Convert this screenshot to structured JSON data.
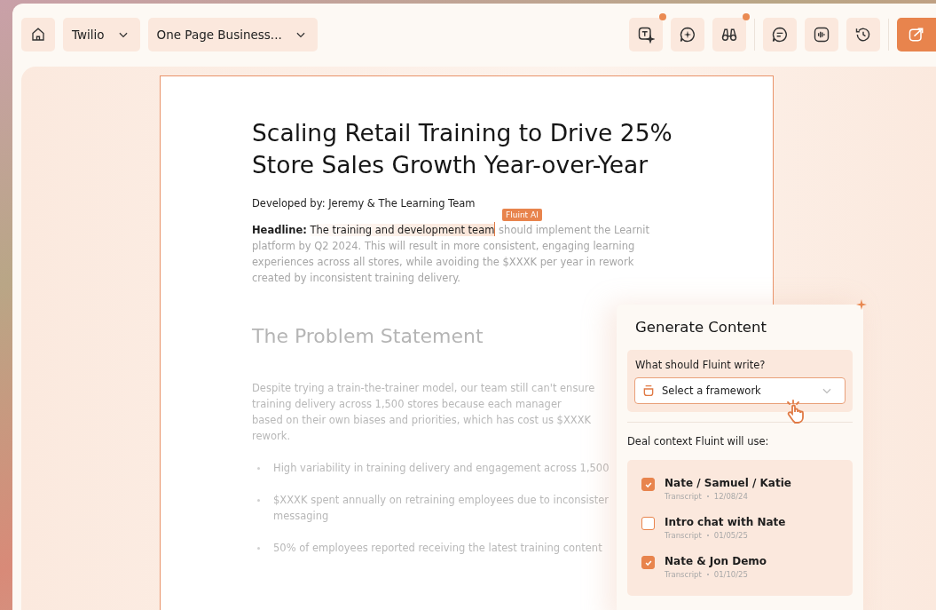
{
  "toolbar": {
    "account": {
      "label": "Twilio"
    },
    "document": {
      "label": "One Page Business..."
    },
    "tool_groups": [
      [
        {
          "badge": true
        },
        {
          "badge": false
        },
        {
          "badge": true
        }
      ],
      [
        {
          "badge": false
        },
        {
          "badge": false
        },
        {
          "badge": false
        }
      ]
    ]
  },
  "document": {
    "title": "Scaling Retail Training to Drive 25% Store Sales Growth Year-over-Year",
    "byline": "Developed by: Jeremy & The Learning Team",
    "headline": {
      "label": "Headline:",
      "highlighted": "The training and development team",
      "rest": "should implement the Learnit platform by Q2 2024. This will result in more consistent, engaging learning experiences across all stores, while avoiding the $XXXK per year in rework created by inconsistent training delivery.",
      "tag": "Fluint AI"
    },
    "section_heading": "The Problem Statement",
    "paragraph_lines": [
      "Despite trying a train-the-trainer model, our team still can't ensure",
      "training delivery across 1,500 stores because each manager",
      "based on their own biases and priorities, which has cost us $XXXK",
      "rework."
    ],
    "bullets": [
      {
        "lines": [
          "High variability in training delivery and engagement across 1,500"
        ]
      },
      {
        "lines": [
          "$XXXK spent annually on retraining employees due to inconsister",
          "messaging"
        ]
      },
      {
        "lines": [
          "50% of employees reported receiving the latest training content"
        ]
      }
    ]
  },
  "panel": {
    "title": "Generate Content",
    "question": "What should Fluint write?",
    "select": {
      "placeholder": "Select a framework"
    },
    "context_label": "Deal context Fluint will use:",
    "sources": [
      {
        "title": "Nate / Samuel / Katie",
        "type": "Transcript",
        "date": "12/08/24",
        "checked": true
      },
      {
        "title": "Intro chat with Nate",
        "type": "Transcript",
        "date": "01/05/25",
        "checked": false
      },
      {
        "title": "Nate & Jon Demo",
        "type": "Transcript",
        "date": "01/10/25",
        "checked": true
      }
    ]
  }
}
